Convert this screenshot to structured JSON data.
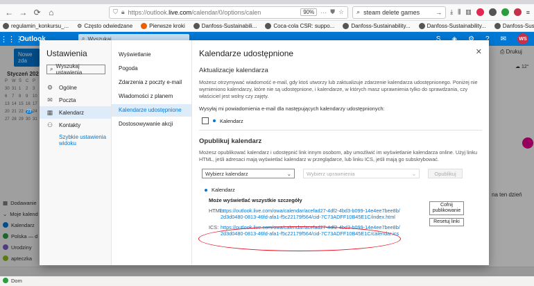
{
  "browser": {
    "url_prefix": "https://outlook.",
    "url_domain": "live.com",
    "url_rest": "/calendar/0/options/calen",
    "zoom": "90%",
    "search_query": "steam delete games"
  },
  "bookmarks": [
    "regulamin_konkursu_...",
    "Często odwiedzane",
    "Pierwsze kroki",
    "Danfoss-Sustainabili...",
    "Coca-cola CSR: suppo...",
    "Danfoss-Sustainability...",
    "Danfoss-Sustainability...",
    "Danfoss-Sustainability..."
  ],
  "outlook": {
    "brand": "Outlook",
    "search_placeholder": "Wyszukaj",
    "avatar_initials": "WS"
  },
  "background": {
    "new_button": "Nowe zda",
    "month_label": "Styczeń 202",
    "mini_calendar": [
      "P",
      "W",
      "Ś",
      "C",
      "P",
      "30",
      "31",
      "1",
      "2",
      "3",
      "6",
      "7",
      "8",
      "9",
      "10",
      "13",
      "14",
      "15",
      "16",
      "17",
      "20",
      "21",
      "22",
      "23",
      "24",
      "27",
      "28",
      "29",
      "30",
      "31"
    ],
    "today": "23",
    "nav_items": [
      "Dodawanie",
      "Moje kalend",
      "Kalendarz",
      "Polska — d",
      "Urodziny",
      "apteczka",
      "iCloud",
      "Dom"
    ],
    "print_label": "Drukuj",
    "weather": "12°",
    "snippet": "na ten dzień"
  },
  "settings": {
    "title": "Ustawienia",
    "search_placeholder": "Wyszukaj ustawienia",
    "nav": [
      {
        "label": "Ogólne",
        "icon": "gear-icon"
      },
      {
        "label": "Poczta",
        "icon": "mail-icon"
      },
      {
        "label": "Kalendarz",
        "icon": "calendar-icon"
      },
      {
        "label": "Kontakty",
        "icon": "contacts-icon"
      }
    ],
    "quick_link": "Szybkie ustawienia widoku",
    "subnav": [
      "Wyświetlanie",
      "Pogoda",
      "Zdarzenia z poczty e-mail",
      "Wiadomości z planem",
      "Kalendarze udostępnione",
      "Dostosowywanie akcji"
    ]
  },
  "panel": {
    "title": "Kalendarze udostępnione",
    "updates_heading": "Aktualizacje kalendarza",
    "updates_text": "Możesz otrzymywać wiadomość e-mail, gdy ktoś utworzy lub zaktualizuje zdarzenie kalendarza udostępnionego. Poniżej nie wymieniono kalendarzy, które nie są udostępnione, i kalendarze, w których masz uprawnienia tylko do sprawdzania, czy właściciel jest wolny czy zajęty.",
    "notify_label": "Wysyłaj mi powiadomienia e-mail dla następujących kalendarzy udostępnionych:",
    "notify_calendar": "Kalendarz",
    "publish_heading": "Opublikuj kalendarz",
    "publish_text": "Możesz opublikować kalendarz i udostępnić link innym osobom, aby umożliwić im wyświetlanie kalendarza online. Użyj linku HTML, jeśli adresaci mają wyświetlać kalendarz w przeglądarce, lub linku ICS, jeśli mają go subskrybować.",
    "select_calendar": "Wybierz kalendarz",
    "select_permissions": "Wybierz uprawnienia",
    "publish_button": "Opublikuj",
    "calendar_name": "Kalendarz",
    "permission_level": "Może wyświetlać wszystkie szczegóły",
    "html_label": "HTML:",
    "html_link": "https://outlook.live.com/owa/calendar/acefad27-4df2-4bd3-b099-14e4ee7bee8b/2d3d0480-0813-46fd-afa1-f5c22179f564/cid-7C73ADFF10B45E1C/index.html",
    "ics_label": "ICS:",
    "ics_link": "https://outlook.live.com/owa/calendar/acefad27-4df2-4bd3-b099-14e4ee7bee8b/2d3d0480-0813-46fd-afa1-f5c22179f564/cid-7C73ADFF10B45E1C/calendar.ics",
    "unpublish_button": "Cofnij publikowanie",
    "reset_button": "Resetuj linki"
  }
}
